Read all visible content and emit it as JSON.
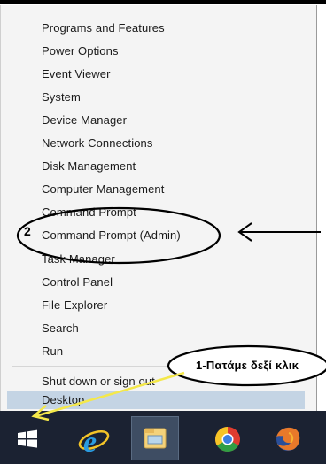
{
  "menu": {
    "items": [
      {
        "label": "Programs and Features"
      },
      {
        "label": "Power Options"
      },
      {
        "label": "Event Viewer"
      },
      {
        "label": "System"
      },
      {
        "label": "Device Manager"
      },
      {
        "label": "Network Connections"
      },
      {
        "label": "Disk Management"
      },
      {
        "label": "Computer Management"
      },
      {
        "label": "Command Prompt"
      },
      {
        "label": "Command Prompt (Admin)"
      },
      {
        "label": "Task Manager"
      },
      {
        "label": "Control Panel"
      },
      {
        "label": "File Explorer"
      },
      {
        "label": "Search"
      },
      {
        "label": "Run"
      }
    ],
    "shutdown_label": "Shut down or sign out",
    "desktop_label": "Desktop"
  },
  "taskbar": {
    "icons": [
      "windows-start-icon",
      "internet-explorer-icon",
      "file-explorer-icon",
      "chrome-icon",
      "firefox-icon"
    ]
  },
  "annotations": {
    "step2": "2",
    "step1": "1-Πατάμε δεξί κλικ"
  },
  "colors": {
    "menu_background": "#f4f4f4",
    "highlight": "#c4d4e4",
    "taskbar": "#1b2232",
    "arrow_yellow": "#f4e84a"
  }
}
